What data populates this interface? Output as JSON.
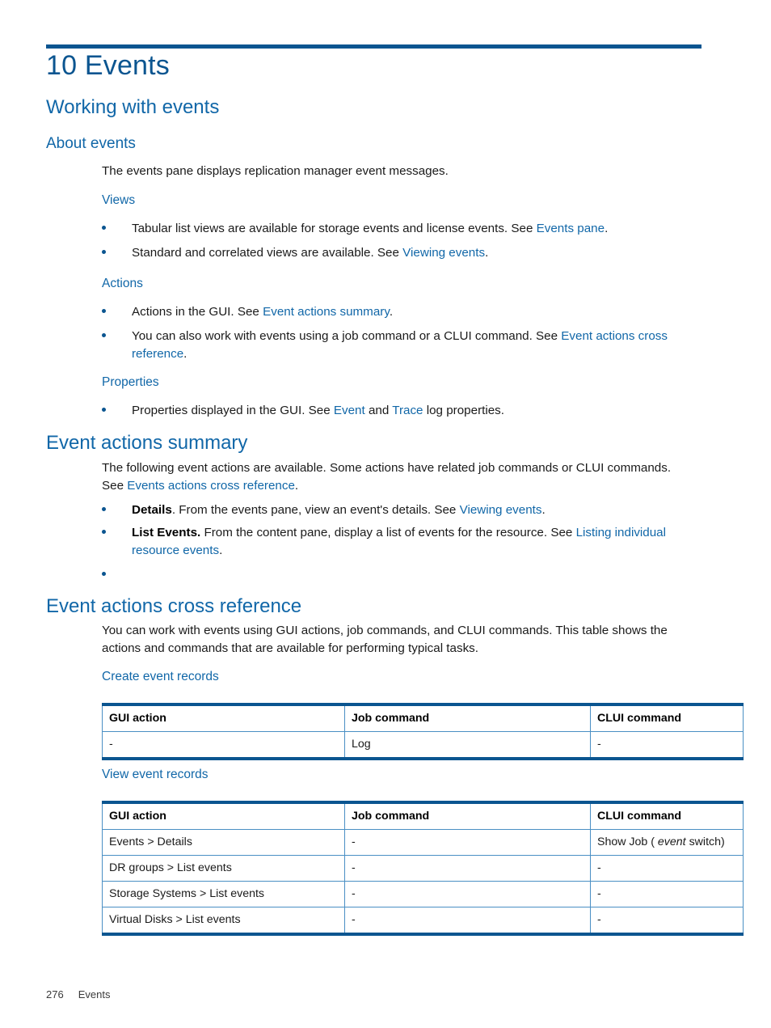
{
  "chapter": {
    "title": "10 Events"
  },
  "sections": {
    "working_with_events": {
      "heading": "Working with events",
      "about_events": {
        "heading": "About events",
        "intro": "The events pane displays replication manager event messages.",
        "views": {
          "heading": "Views",
          "items": [
            {
              "pre": "Tabular list views are available for storage events and license events. See ",
              "link": "Events pane",
              "post": "."
            },
            {
              "pre": "Standard and correlated views are available. See ",
              "link": "Viewing events",
              "post": "."
            }
          ]
        },
        "actions": {
          "heading": "Actions",
          "items": [
            {
              "pre": "Actions in the GUI. See ",
              "link": "Event actions summary",
              "post": "."
            },
            {
              "pre": "You can also work with events using a job command or a CLUI command. See ",
              "link": "Event actions cross reference",
              "post": "."
            }
          ]
        },
        "properties": {
          "heading": "Properties",
          "items": [
            {
              "pre": "Properties displayed in the GUI. See ",
              "link": "Event",
              "mid": " and ",
              "link2": "Trace",
              "post": " log properties."
            }
          ]
        }
      }
    },
    "event_actions_summary": {
      "heading": "Event actions summary",
      "intro_pre": "The following event actions are available. Some actions have related job commands or CLUI commands. See ",
      "intro_link": "Events actions cross reference",
      "intro_post": ".",
      "items": [
        {
          "term": "Details",
          "pre": ". From the events pane, view an event's details. See ",
          "link": "Viewing events",
          "post": "."
        },
        {
          "term": "List Events.",
          "pre": " From the content pane, display a list of events for the resource. See ",
          "link": "Listing individual resource events",
          "post": "."
        },
        {
          "term": "",
          "pre": "",
          "link": "",
          "post": ""
        }
      ]
    },
    "event_actions_cross_reference": {
      "heading": "Event actions cross reference",
      "intro": "You can work with events using GUI actions, job commands, and CLUI commands. This table shows the actions and commands that are available for performing typical tasks.",
      "create_event_records": {
        "heading": "Create event records",
        "table": {
          "columns": [
            "GUI action",
            "Job command",
            "CLUI command"
          ],
          "rows": [
            [
              "-",
              "Log",
              "-"
            ]
          ]
        }
      },
      "view_event_records": {
        "heading": "View event records",
        "table": {
          "columns": [
            "GUI action",
            "Job command",
            "CLUI command"
          ],
          "rows": [
            [
              "Events > Details",
              "-",
              "Show Job ( event switch)"
            ],
            [
              "DR groups > List events",
              "-",
              "-"
            ],
            [
              "Storage Systems > List events",
              "-",
              "-"
            ],
            [
              "Virtual Disks > List events",
              "-",
              "-"
            ]
          ],
          "row0_clui": {
            "pre": "Show Job ( ",
            "italic": "event",
            "post": " switch)"
          }
        }
      }
    }
  },
  "footer": {
    "page_number": "276",
    "chapter_name": "Events"
  },
  "colors": {
    "rule": "#0b5590",
    "heading_blue": "#1167a8",
    "link_blue": "#1167a8",
    "table_border": "#4a8fc4",
    "body_text": "#1a1a1a"
  }
}
